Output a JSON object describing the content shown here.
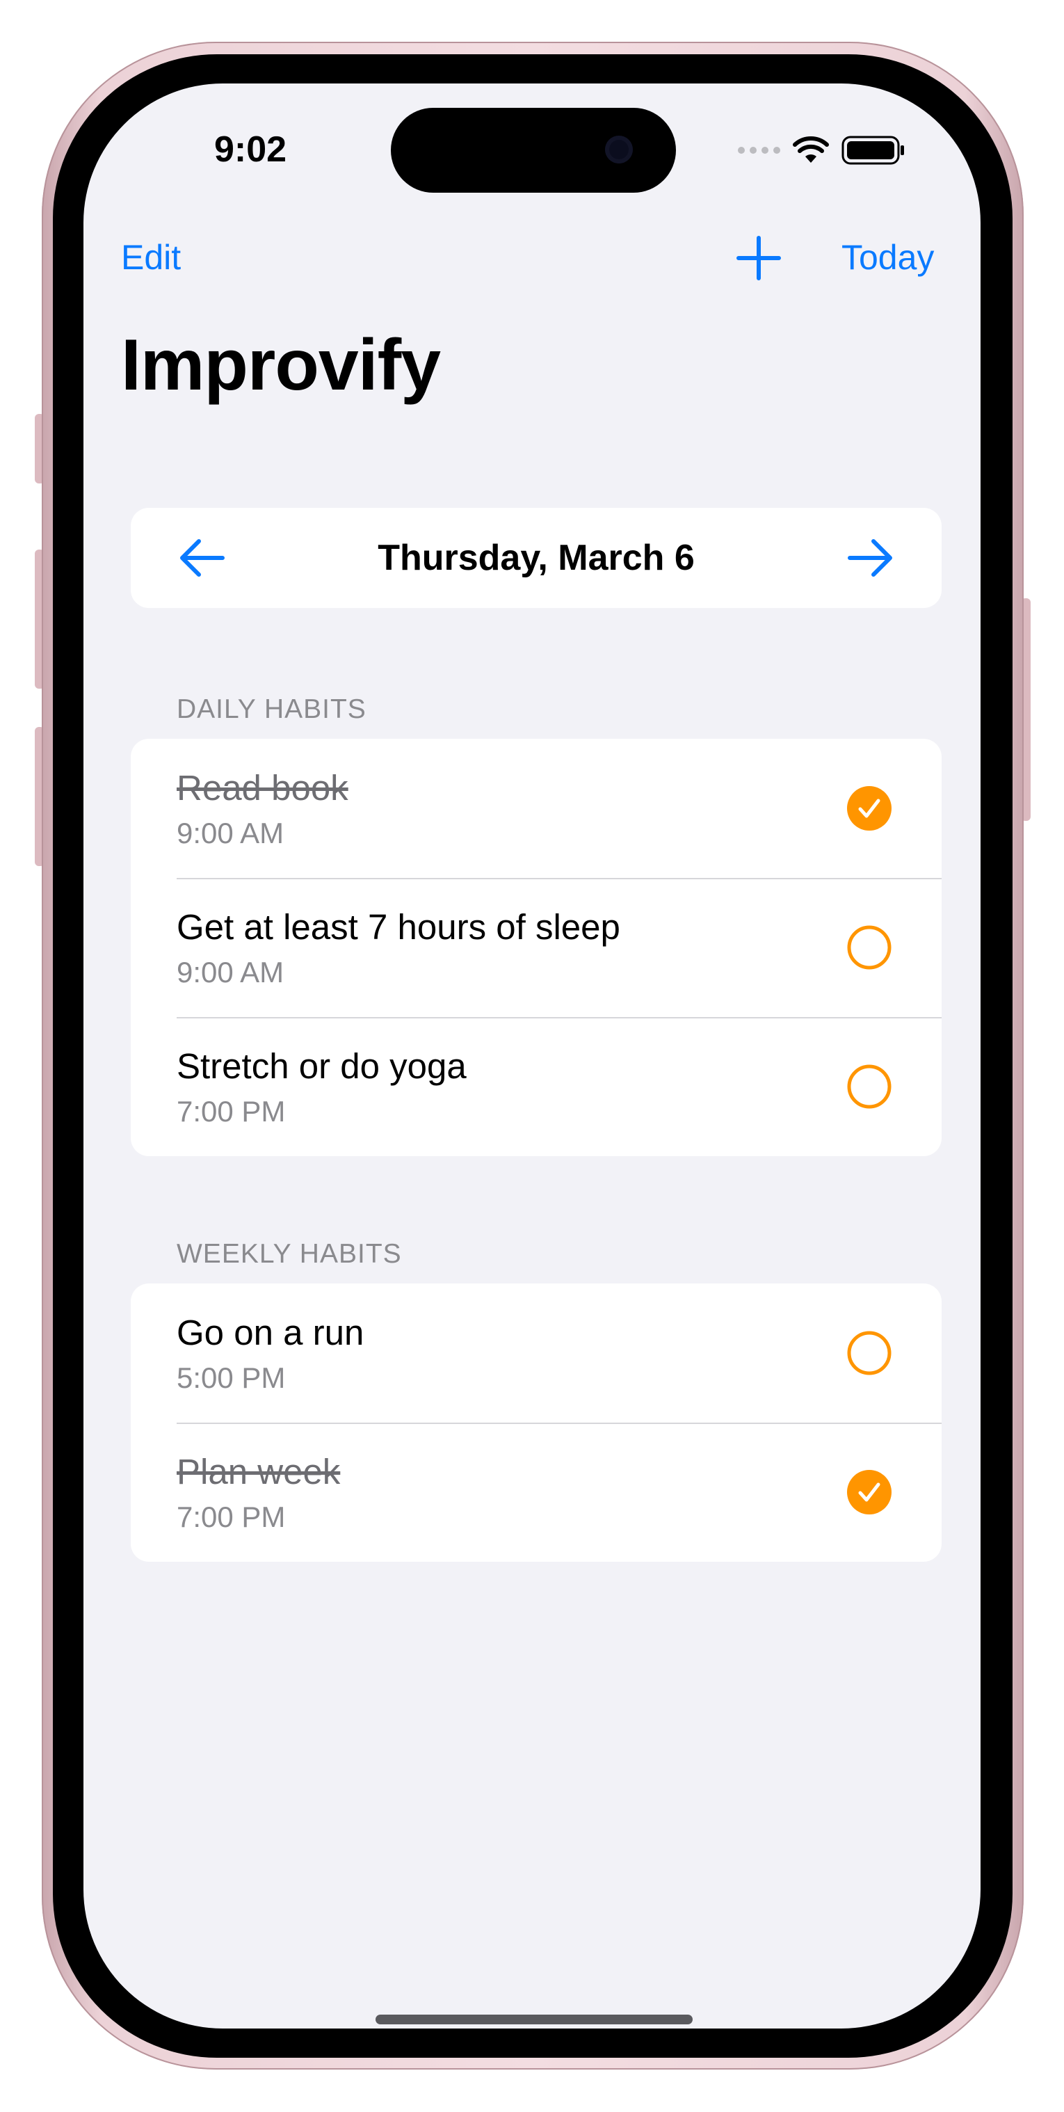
{
  "status_bar": {
    "time": "9:02"
  },
  "nav": {
    "edit_label": "Edit",
    "today_label": "Today"
  },
  "title": "Improvify",
  "date_picker": {
    "label": "Thursday, March 6"
  },
  "sections": {
    "daily": {
      "header": "DAILY HABITS",
      "items": [
        {
          "title": "Read book",
          "time": "9:00 AM",
          "completed": true
        },
        {
          "title": "Get at least 7 hours of sleep",
          "time": "9:00 AM",
          "completed": false
        },
        {
          "title": "Stretch or do yoga",
          "time": "7:00 PM",
          "completed": false
        }
      ]
    },
    "weekly": {
      "header": "WEEKLY HABITS",
      "items": [
        {
          "title": "Go on a run",
          "time": "5:00 PM",
          "completed": false
        },
        {
          "title": "Plan week",
          "time": "7:00 PM",
          "completed": true
        }
      ]
    }
  },
  "colors": {
    "accent": "#0a7aff",
    "check": "#ff9500",
    "background": "#f2f2f7"
  }
}
